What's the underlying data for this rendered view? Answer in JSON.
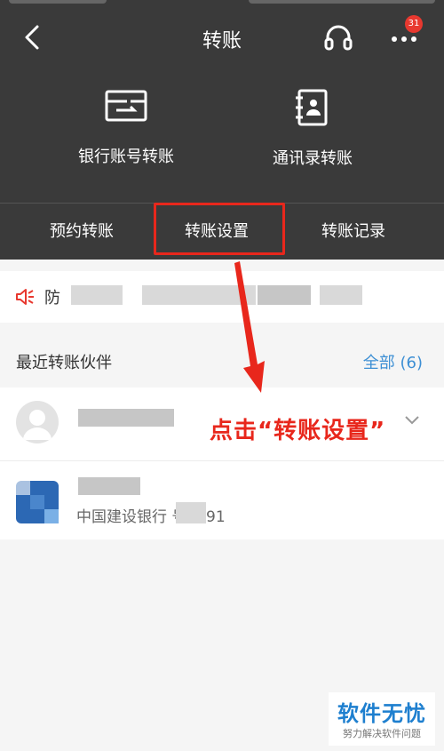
{
  "header": {
    "title": "转账",
    "badge_count": "31"
  },
  "features": [
    {
      "label": "银行账号转账",
      "icon": "bank-card-icon"
    },
    {
      "label": "通讯录转账",
      "icon": "contacts-book-icon"
    }
  ],
  "subtabs": [
    {
      "label": "预约转账"
    },
    {
      "label": "转账设置"
    },
    {
      "label": "转账记录"
    }
  ],
  "notice": {
    "text": "防",
    "icon": "speaker-icon"
  },
  "recent": {
    "title": "最近转账伙伴",
    "all_label": "全部 (6)",
    "items": [
      {
        "bank_text": ""
      },
      {
        "bank_text": "中国建设银行          号2091"
      }
    ]
  },
  "annotation": {
    "text": "点击“转账设置”"
  },
  "watermark": {
    "title": "软件无忧",
    "subtitle": "努力解决软件问题"
  },
  "colors": {
    "header_bg": "#3a3a3a",
    "highlight_red": "#e8271c",
    "link_blue": "#3d8fd4",
    "badge_red": "#e8382f"
  }
}
